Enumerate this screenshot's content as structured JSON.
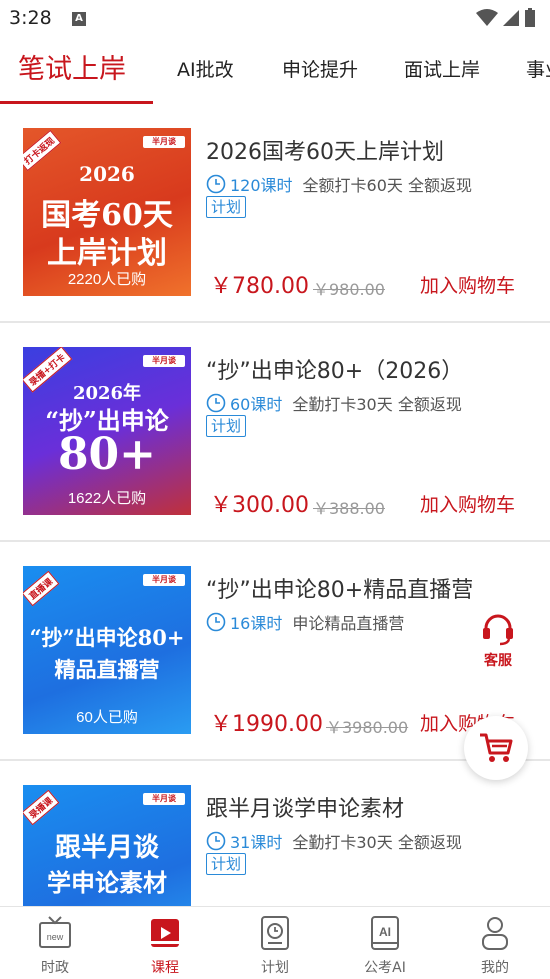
{
  "status": {
    "time": "3:28"
  },
  "tabs": [
    {
      "label": "笔试上岸",
      "active": true
    },
    {
      "label": "AI批改"
    },
    {
      "label": "申论提升"
    },
    {
      "label": "面试上岸"
    },
    {
      "label": "事业"
    }
  ],
  "courses": [
    {
      "title": "2026国考60天上岸计划",
      "hours": "120课时",
      "desc": "全额打卡60天 全额返现",
      "tag": "计划",
      "price": "￥780.00",
      "orig_price": "￥980.00",
      "cart_label": "加入购物车",
      "thumb": {
        "corner": "打卡返现",
        "brand": "半月谈",
        "lines": [
          "2026",
          "国考60天",
          "上岸计划"
        ],
        "buyers": "2220人已购"
      }
    },
    {
      "title": "“抄”出申论80+（2026）",
      "hours": "60课时",
      "desc": "全勤打卡30天 全额返现",
      "tag": "计划",
      "price": "￥300.00",
      "orig_price": "￥388.00",
      "cart_label": "加入购物车",
      "thumb": {
        "corner": "录播+打卡",
        "brand": "半月谈",
        "lines": [
          "2026年",
          "“抄”出申论",
          "80+"
        ],
        "buyers": "1622人已购"
      }
    },
    {
      "title": "“抄”出申论80+精品直播营",
      "hours": "16课时",
      "desc": "申论精品直播营",
      "tag": "",
      "price": "￥1990.00",
      "orig_price": "￥3980.00",
      "cart_label": "加入购物车",
      "thumb": {
        "corner": "直播课",
        "brand": "半月谈",
        "lines": [
          "“抄”出申论80+",
          "精品直播营"
        ],
        "buyers": "60人已购"
      }
    },
    {
      "title": "跟半月谈学申论素材",
      "hours": "31课时",
      "desc": "全勤打卡30天 全额返现",
      "tag": "计划",
      "thumb": {
        "corner": "录播课",
        "brand": "半月谈",
        "lines": [
          "跟半月谈",
          "学申论素材"
        ],
        "buyers": ""
      }
    }
  ],
  "floating": {
    "service_label": "客服"
  },
  "bottom_nav": [
    {
      "label": "时政",
      "icon": "news-tv-icon"
    },
    {
      "label": "课程",
      "icon": "course-play-icon",
      "active": true
    },
    {
      "label": "计划",
      "icon": "plan-clock-icon"
    },
    {
      "label": "公考AI",
      "icon": "ai-book-icon"
    },
    {
      "label": "我的",
      "icon": "profile-person-icon"
    }
  ],
  "colors": {
    "accent": "#c8161d",
    "link": "#2a8ad8"
  }
}
